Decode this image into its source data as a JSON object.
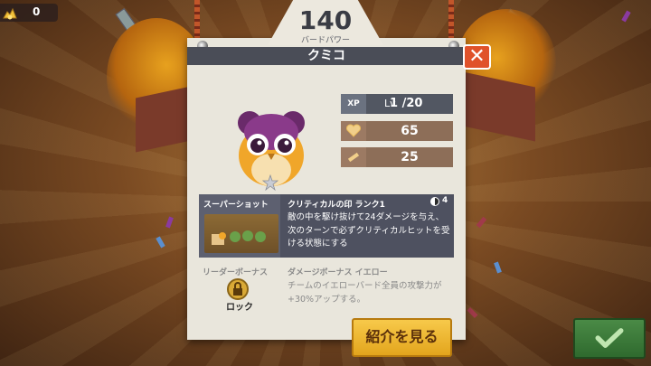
{
  "currency": {
    "amount": "0",
    "icon": "gold-pile-icon"
  },
  "header": {
    "power_value": "140",
    "power_label": "バードパワー",
    "bird_name": "クミコ"
  },
  "close_icon": "close-icon",
  "stats": {
    "xp_badge": "XP",
    "level_prefix": "Lv",
    "level_value": "1 /20",
    "health_value": "65",
    "attack_value": "25",
    "health_icon": "heart-icon",
    "attack_icon": "sword-icon"
  },
  "super_shot": {
    "title": "スーパーショット",
    "name": "クリティカルの印 ランク1",
    "cost": "4",
    "description": "敵の中を駆け抜けて24ダメージを与え、次のターンで必ずクリティカルヒットを受ける状態にする"
  },
  "leader_bonus": {
    "title": "リーダーボーナス",
    "lock_label": "ロック",
    "name": "ダメージボーナス イエロー",
    "description": "チームのイエローバード全員の攻撃力が+30%アップする。"
  },
  "buttons": {
    "intro_label": "紹介を見る",
    "confirm_icon": "checkmark-icon"
  },
  "colors": {
    "accent": "#e0522a",
    "gold": "#f7c94a",
    "confirm": "#3f7a3c",
    "panel": "#4e5160"
  }
}
